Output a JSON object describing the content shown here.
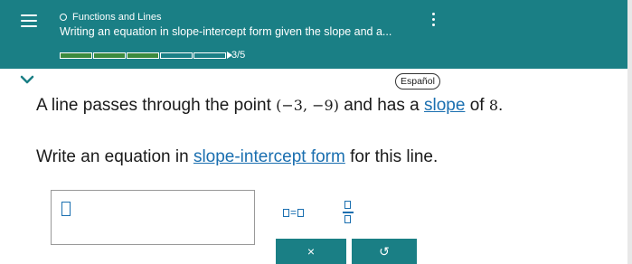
{
  "header": {
    "topic": "Functions and Lines",
    "lesson_title": "Writing an equation in slope-intercept form given the slope and a...",
    "progress_text": "3/5",
    "progress_completed": 3,
    "progress_total": 5
  },
  "language_button": "Español",
  "question": {
    "prefix": "A line passes through the point ",
    "point": "(−3, −9)",
    "middle": " and has a ",
    "slope_link": "slope",
    "of_text": " of ",
    "slope_value": "8",
    "suffix": "."
  },
  "instruction": {
    "prefix": "Write an equation in ",
    "link": "slope-intercept form",
    "suffix": " for this line."
  },
  "palette": {
    "equals": "=",
    "clear": "×",
    "undo": "↺"
  },
  "colors": {
    "header": "#1a7f85",
    "link": "#1a6fb0",
    "progress_filled": "#3b8a3e"
  },
  "icons": [
    "menu-icon",
    "circle-icon",
    "more-vertical-icon",
    "chevron-down-icon",
    "undo-icon"
  ]
}
